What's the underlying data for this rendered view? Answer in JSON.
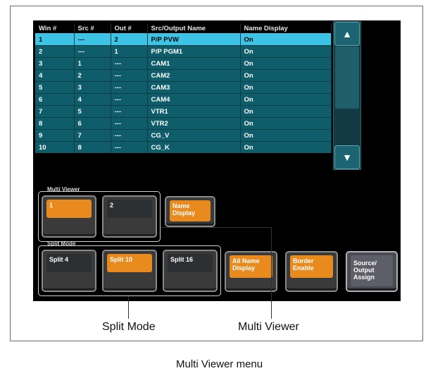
{
  "table": {
    "headers": [
      "Win #",
      "Src #",
      "Out #",
      "Src/Output Name",
      "Name Display"
    ],
    "rows": [
      [
        "1",
        "---",
        "2",
        "P/P PVW",
        "On"
      ],
      [
        "2",
        "---",
        "1",
        "P/P PGM1",
        "On"
      ],
      [
        "3",
        "1",
        "---",
        "CAM1",
        "On"
      ],
      [
        "4",
        "2",
        "---",
        "CAM2",
        "On"
      ],
      [
        "5",
        "3",
        "---",
        "CAM3",
        "On"
      ],
      [
        "6",
        "4",
        "---",
        "CAM4",
        "On"
      ],
      [
        "7",
        "5",
        "---",
        "VTR1",
        "On"
      ],
      [
        "8",
        "6",
        "---",
        "VTR2",
        "On"
      ],
      [
        "9",
        "7",
        "---",
        "CG_V",
        "On"
      ],
      [
        "10",
        "8",
        "---",
        "CG_K",
        "On"
      ]
    ],
    "selected_row": 0
  },
  "scrollbar": {
    "up_icon": "▲",
    "down_icon": "▼"
  },
  "groups": {
    "multi_viewer": "Multi Viewer",
    "split_mode": "Split Mode"
  },
  "buttons": {
    "mv1": {
      "label": "1",
      "state": "on"
    },
    "mv2": {
      "label": "2",
      "state": "off"
    },
    "name_display": {
      "label": "Name\nDisplay",
      "state": "on"
    },
    "split4": {
      "label": "Split 4",
      "state": "off"
    },
    "split10": {
      "label": "Split 10",
      "state": "on"
    },
    "split16": {
      "label": "Split 16",
      "state": "off"
    },
    "all_name_display": {
      "label": "All Name\nDisplay",
      "state": "on"
    },
    "border_enable": {
      "label": "Border\nEnable",
      "state": "on"
    },
    "source_output_assign": {
      "label": "Source/\nOutput\nAssign",
      "state": "off"
    }
  },
  "callouts": {
    "split_mode": "Split Mode",
    "multi_viewer": "Multi Viewer"
  },
  "figure_caption": "Multi Viewer menu",
  "colors": {
    "accent": "#e98a1f",
    "table_bg": "#0f5d6a",
    "selected_row": "#3cc3e6"
  }
}
